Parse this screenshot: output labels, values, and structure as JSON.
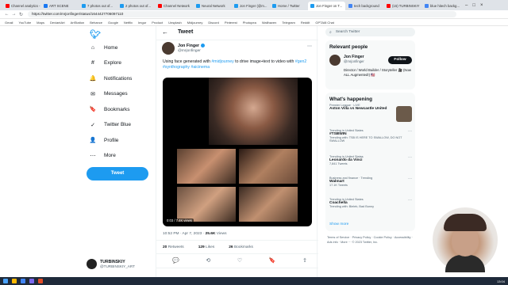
{
  "browser": {
    "tabs": [
      {
        "label": "Channel analytics - YouTube",
        "color": "#ff0000"
      },
      {
        "label": "ART SCENE",
        "color": "#1877f2"
      },
      {
        "label": "7 photos out of...",
        "color": "#1d9bf0"
      },
      {
        "label": "2 photos out of...",
        "color": "#1d9bf0"
      },
      {
        "label": "Channel Network",
        "color": "#ff0000"
      },
      {
        "label": "Neural Network",
        "color": "#1d9bf0"
      },
      {
        "label": "Jon Finger (@m...",
        "color": "#1d9bf0"
      },
      {
        "label": "Home / Twitter",
        "color": "#1d9bf0"
      },
      {
        "label": "Jon Finger on T...",
        "color": "#1d9bf0",
        "active": true
      },
      {
        "label": "tech background",
        "color": "#4285f4"
      },
      {
        "label": "(15) TURBINSKIY",
        "color": "#ff0000"
      },
      {
        "label": "blue hitech backg...",
        "color": "#4285f4"
      }
    ],
    "url": "https://twitter.com/mrjonfinger/status/1644427706097110",
    "bookmarks": [
      "Gmail",
      "YouTube",
      "Maps",
      "DeviantArt",
      "ArtStation",
      "Behance",
      "Google",
      "Netflix",
      "Imgur",
      "Product",
      "Unsplash",
      "Midjourney",
      "Discord",
      "Pinterest",
      "Photopea",
      "Wallhaven",
      "Telegram",
      "Reddit",
      "GPTAI8 Chat"
    ]
  },
  "leftnav": {
    "items": [
      {
        "icon": "⌂",
        "label": "Home"
      },
      {
        "icon": "#",
        "label": "Explore"
      },
      {
        "icon": "🔔",
        "label": "Notifications"
      },
      {
        "icon": "✉",
        "label": "Messages"
      },
      {
        "icon": "🔖",
        "label": "Bookmarks"
      },
      {
        "icon": "✓",
        "label": "Twitter Blue"
      },
      {
        "icon": "👤",
        "label": "Profile"
      },
      {
        "icon": "⋯",
        "label": "More"
      }
    ],
    "tweet_button": "Tweet",
    "account": {
      "name": "TURBINSKIY",
      "handle": "@TURBINSKIY_ART"
    }
  },
  "main": {
    "back_icon": "←",
    "title": "Tweet",
    "tweet": {
      "author": "Jon Finger",
      "handle": "@mrjonfinger",
      "text_before": "Using face generated with ",
      "link1": "#midjourney",
      "text_mid": " to drive image+text to video with ",
      "link2": "#gen2",
      "text_end": "",
      "hashtags": "#synthography #aicinema",
      "duration": "0:03 / 7.4K views",
      "time": "10:52 PM · Apr 7, 2023",
      "views": "25.6K",
      "views_label": "Views",
      "retweets": "20",
      "retweets_label": "Retweets",
      "quotes": "129",
      "quotes_label": "Likes",
      "likes": "26",
      "likes_label": "Bookmarks"
    },
    "actions": [
      "💬",
      "⟲",
      "♡",
      "🔖",
      "⇪"
    ]
  },
  "right": {
    "search_placeholder": "Search Twitter",
    "relevant": {
      "title": "Relevant people",
      "name": "Jon Finger",
      "handle": "@mrjonfinger",
      "follow": "Follow",
      "bio": "Director / World Builder / Storyteller 🎥 (Now ALL Augmented!) 🇺🇸"
    },
    "happening": {
      "title": "What's happening",
      "trends": [
        {
          "cat": "Premier League · LIVE",
          "name": "Aston Villa vs Newcastle United",
          "count": "",
          "thumb": true
        },
        {
          "cat": "Trending in United States",
          "name": "#TSBWIN",
          "count": "Trending with: TSB IS HERE TO SWALLOW, DO NOT SWALLOW"
        },
        {
          "cat": "Trending in United States",
          "name": "Leonardo da Vinci",
          "count": "7,841 Tweets"
        },
        {
          "cat": "Business and finance · Trending",
          "name": "Walmart",
          "count": "17.1K Tweets"
        },
        {
          "cat": "Trending in United States",
          "name": "Coachella",
          "count": "Trending with: Bieleb, Bad Bunny"
        }
      ],
      "show_more": "Show more"
    },
    "footer": "Terms of Service · Privacy Policy · Cookie Policy · Accessibility · Ads info · More ··· © 2023 Twitter, Inc."
  },
  "taskbar": {
    "clock": "13:04"
  }
}
